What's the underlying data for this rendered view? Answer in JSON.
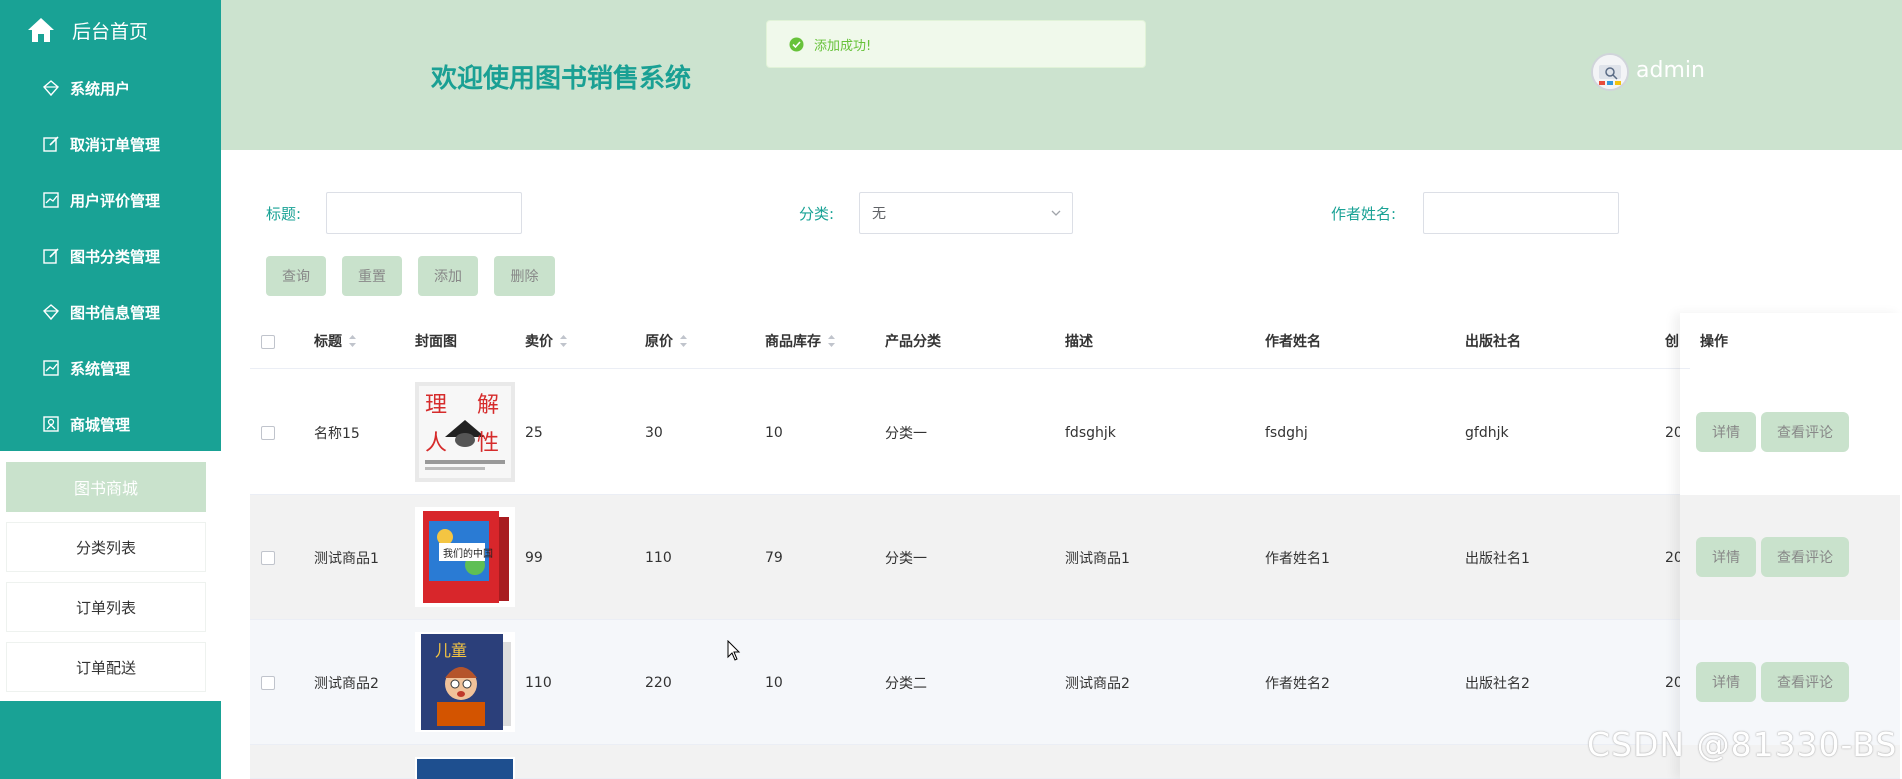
{
  "sidebar": {
    "home_label": "后台首页",
    "menu": [
      {
        "label": "系统用户",
        "icon": "diamond-icon"
      },
      {
        "label": "取消订单管理",
        "icon": "edit-icon"
      },
      {
        "label": "用户评价管理",
        "icon": "chart-icon"
      },
      {
        "label": "图书分类管理",
        "icon": "edit-icon"
      },
      {
        "label": "图书信息管理",
        "icon": "diamond-icon"
      },
      {
        "label": "系统管理",
        "icon": "chart-icon"
      },
      {
        "label": "商城管理",
        "icon": "profile-icon"
      }
    ],
    "submenu_head": "图书商城",
    "submenu": [
      "分类列表",
      "订单列表",
      "订单配送"
    ]
  },
  "header": {
    "title": "欢迎使用图书销售系统",
    "username": "admin"
  },
  "toast": {
    "message": "添加成功!",
    "color": "#67c23a"
  },
  "filters": {
    "title_label": "标题:",
    "category_label": "分类:",
    "category_value": "无",
    "author_label": "作者姓名:"
  },
  "buttons": {
    "search": "查询",
    "reset": "重置",
    "add": "添加",
    "delete": "删除"
  },
  "table": {
    "headers": [
      "标题",
      "封面图",
      "卖价",
      "原价",
      "商品库存",
      "产品分类",
      "描述",
      "作者姓名",
      "出版社名",
      "创",
      "操作"
    ],
    "rows": [
      {
        "title": "名称15",
        "price": "25",
        "orig": "30",
        "stock": "10",
        "category": "分类一",
        "desc": "fdsghjk",
        "author": "fsdghj",
        "publisher": "gfdhjk",
        "created": "20",
        "cover": "book-cover-1"
      },
      {
        "title": "测试商品1",
        "price": "99",
        "orig": "110",
        "stock": "79",
        "category": "分类一",
        "desc": "测试商品1",
        "author": "作者姓名1",
        "publisher": "出版社名1",
        "created": "20",
        "cover": "book-cover-2"
      },
      {
        "title": "测试商品2",
        "price": "110",
        "orig": "220",
        "stock": "10",
        "category": "分类二",
        "desc": "测试商品2",
        "author": "作者姓名2",
        "publisher": "出版社名2",
        "created": "20",
        "cover": "book-cover-3"
      }
    ],
    "detail_btn": "详情",
    "review_btn": "查看评论"
  },
  "cover_text": {
    "c1_top_left": "理",
    "c1_top_right": "解",
    "c1_bottom_left": "人",
    "c1_bottom_right": "性",
    "c2": "我们的中国",
    "c3": "儿童"
  },
  "watermark": "CSDN @81330-BS",
  "colors": {
    "sidebar": "#19a295",
    "header": "#cce3cf",
    "accent": "#1aa094",
    "button": "#c9e2cc"
  }
}
